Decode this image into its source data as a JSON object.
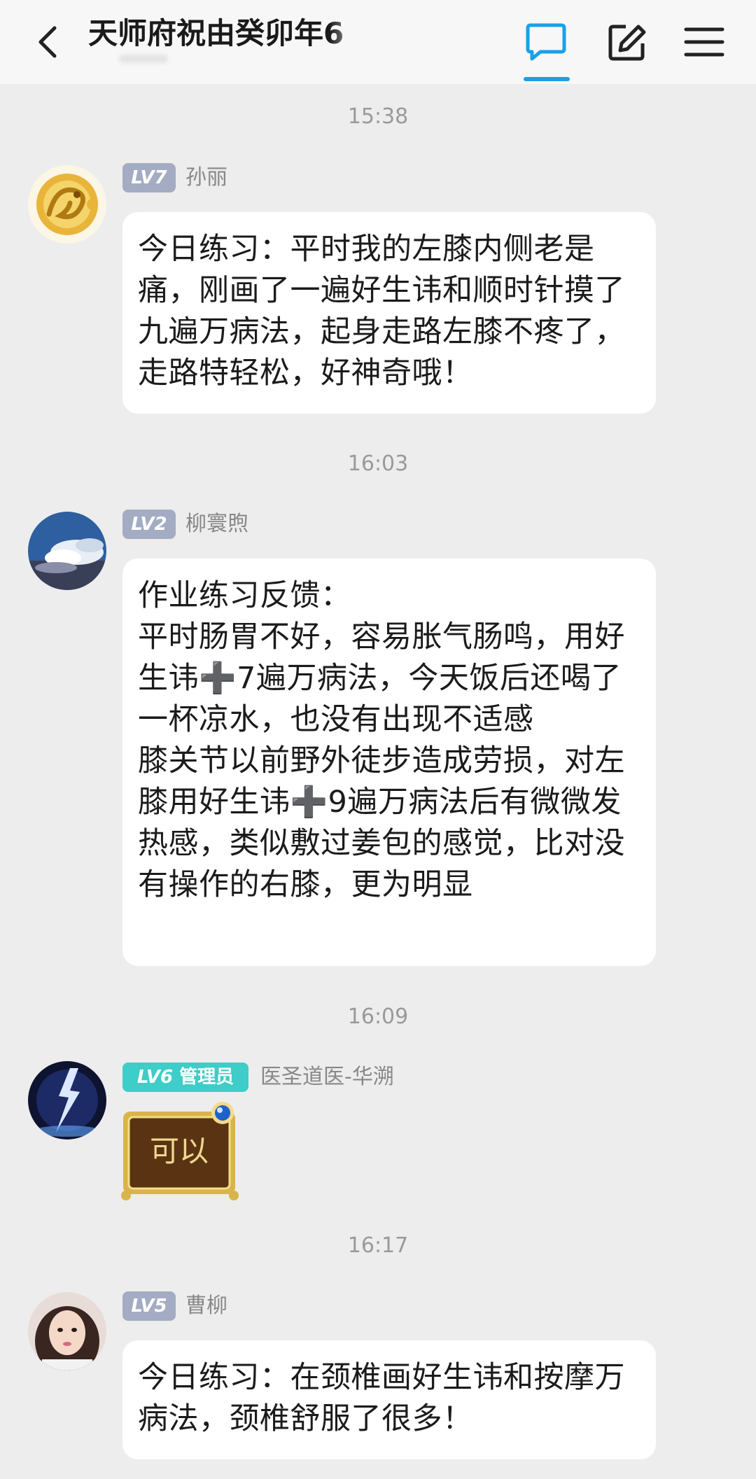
{
  "header": {
    "title": "天师府祝由癸卯年6"
  },
  "messages": [
    {
      "time": "15:38",
      "level": "LV7",
      "name": "孙丽",
      "text": "今日练习：平时我的左膝内侧老是痛，刚画了一遍好生讳和顺时针摸了九遍万病法，起身走路左膝不疼了，走路特轻松，好神奇哦！"
    },
    {
      "time": "16:03",
      "level": "LV2",
      "name": "柳寰煦",
      "text": "作业练习反馈：\n平时肠胃不好，容易胀气肠鸣，用好生讳➕7遍万病法，今天饭后还喝了一杯凉水，也没有出现不适感\n膝关节以前野外徒步造成劳损，对左膝用好生讳➕9遍万病法后有微微发热感，类似敷过姜包的感觉，比对没有操作的右膝，更为明显"
    },
    {
      "time": "16:09",
      "level": "LV6",
      "role": "管理员",
      "name": "医圣道医-华溯",
      "sticker_text": "可以"
    },
    {
      "time": "16:17",
      "level": "LV5",
      "name": "曹柳",
      "text": "今日练习：在颈椎画好生讳和按摩万病法，颈椎舒服了很多！"
    }
  ]
}
